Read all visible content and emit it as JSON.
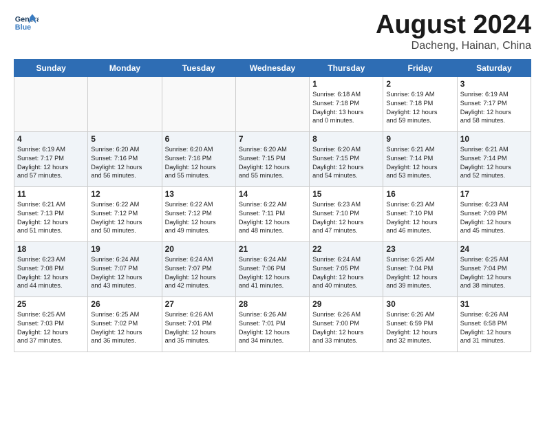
{
  "header": {
    "logo_line1": "General",
    "logo_line2": "Blue",
    "month": "August 2024",
    "location": "Dacheng, Hainan, China"
  },
  "weekdays": [
    "Sunday",
    "Monday",
    "Tuesday",
    "Wednesday",
    "Thursday",
    "Friday",
    "Saturday"
  ],
  "weeks": [
    [
      {
        "day": "",
        "info": ""
      },
      {
        "day": "",
        "info": ""
      },
      {
        "day": "",
        "info": ""
      },
      {
        "day": "",
        "info": ""
      },
      {
        "day": "1",
        "info": "Sunrise: 6:18 AM\nSunset: 7:18 PM\nDaylight: 13 hours\nand 0 minutes."
      },
      {
        "day": "2",
        "info": "Sunrise: 6:19 AM\nSunset: 7:18 PM\nDaylight: 12 hours\nand 59 minutes."
      },
      {
        "day": "3",
        "info": "Sunrise: 6:19 AM\nSunset: 7:17 PM\nDaylight: 12 hours\nand 58 minutes."
      }
    ],
    [
      {
        "day": "4",
        "info": "Sunrise: 6:19 AM\nSunset: 7:17 PM\nDaylight: 12 hours\nand 57 minutes."
      },
      {
        "day": "5",
        "info": "Sunrise: 6:20 AM\nSunset: 7:16 PM\nDaylight: 12 hours\nand 56 minutes."
      },
      {
        "day": "6",
        "info": "Sunrise: 6:20 AM\nSunset: 7:16 PM\nDaylight: 12 hours\nand 55 minutes."
      },
      {
        "day": "7",
        "info": "Sunrise: 6:20 AM\nSunset: 7:15 PM\nDaylight: 12 hours\nand 55 minutes."
      },
      {
        "day": "8",
        "info": "Sunrise: 6:20 AM\nSunset: 7:15 PM\nDaylight: 12 hours\nand 54 minutes."
      },
      {
        "day": "9",
        "info": "Sunrise: 6:21 AM\nSunset: 7:14 PM\nDaylight: 12 hours\nand 53 minutes."
      },
      {
        "day": "10",
        "info": "Sunrise: 6:21 AM\nSunset: 7:14 PM\nDaylight: 12 hours\nand 52 minutes."
      }
    ],
    [
      {
        "day": "11",
        "info": "Sunrise: 6:21 AM\nSunset: 7:13 PM\nDaylight: 12 hours\nand 51 minutes."
      },
      {
        "day": "12",
        "info": "Sunrise: 6:22 AM\nSunset: 7:12 PM\nDaylight: 12 hours\nand 50 minutes."
      },
      {
        "day": "13",
        "info": "Sunrise: 6:22 AM\nSunset: 7:12 PM\nDaylight: 12 hours\nand 49 minutes."
      },
      {
        "day": "14",
        "info": "Sunrise: 6:22 AM\nSunset: 7:11 PM\nDaylight: 12 hours\nand 48 minutes."
      },
      {
        "day": "15",
        "info": "Sunrise: 6:23 AM\nSunset: 7:10 PM\nDaylight: 12 hours\nand 47 minutes."
      },
      {
        "day": "16",
        "info": "Sunrise: 6:23 AM\nSunset: 7:10 PM\nDaylight: 12 hours\nand 46 minutes."
      },
      {
        "day": "17",
        "info": "Sunrise: 6:23 AM\nSunset: 7:09 PM\nDaylight: 12 hours\nand 45 minutes."
      }
    ],
    [
      {
        "day": "18",
        "info": "Sunrise: 6:23 AM\nSunset: 7:08 PM\nDaylight: 12 hours\nand 44 minutes."
      },
      {
        "day": "19",
        "info": "Sunrise: 6:24 AM\nSunset: 7:07 PM\nDaylight: 12 hours\nand 43 minutes."
      },
      {
        "day": "20",
        "info": "Sunrise: 6:24 AM\nSunset: 7:07 PM\nDaylight: 12 hours\nand 42 minutes."
      },
      {
        "day": "21",
        "info": "Sunrise: 6:24 AM\nSunset: 7:06 PM\nDaylight: 12 hours\nand 41 minutes."
      },
      {
        "day": "22",
        "info": "Sunrise: 6:24 AM\nSunset: 7:05 PM\nDaylight: 12 hours\nand 40 minutes."
      },
      {
        "day": "23",
        "info": "Sunrise: 6:25 AM\nSunset: 7:04 PM\nDaylight: 12 hours\nand 39 minutes."
      },
      {
        "day": "24",
        "info": "Sunrise: 6:25 AM\nSunset: 7:04 PM\nDaylight: 12 hours\nand 38 minutes."
      }
    ],
    [
      {
        "day": "25",
        "info": "Sunrise: 6:25 AM\nSunset: 7:03 PM\nDaylight: 12 hours\nand 37 minutes."
      },
      {
        "day": "26",
        "info": "Sunrise: 6:25 AM\nSunset: 7:02 PM\nDaylight: 12 hours\nand 36 minutes."
      },
      {
        "day": "27",
        "info": "Sunrise: 6:26 AM\nSunset: 7:01 PM\nDaylight: 12 hours\nand 35 minutes."
      },
      {
        "day": "28",
        "info": "Sunrise: 6:26 AM\nSunset: 7:01 PM\nDaylight: 12 hours\nand 34 minutes."
      },
      {
        "day": "29",
        "info": "Sunrise: 6:26 AM\nSunset: 7:00 PM\nDaylight: 12 hours\nand 33 minutes."
      },
      {
        "day": "30",
        "info": "Sunrise: 6:26 AM\nSunset: 6:59 PM\nDaylight: 12 hours\nand 32 minutes."
      },
      {
        "day": "31",
        "info": "Sunrise: 6:26 AM\nSunset: 6:58 PM\nDaylight: 12 hours\nand 31 minutes."
      }
    ]
  ]
}
